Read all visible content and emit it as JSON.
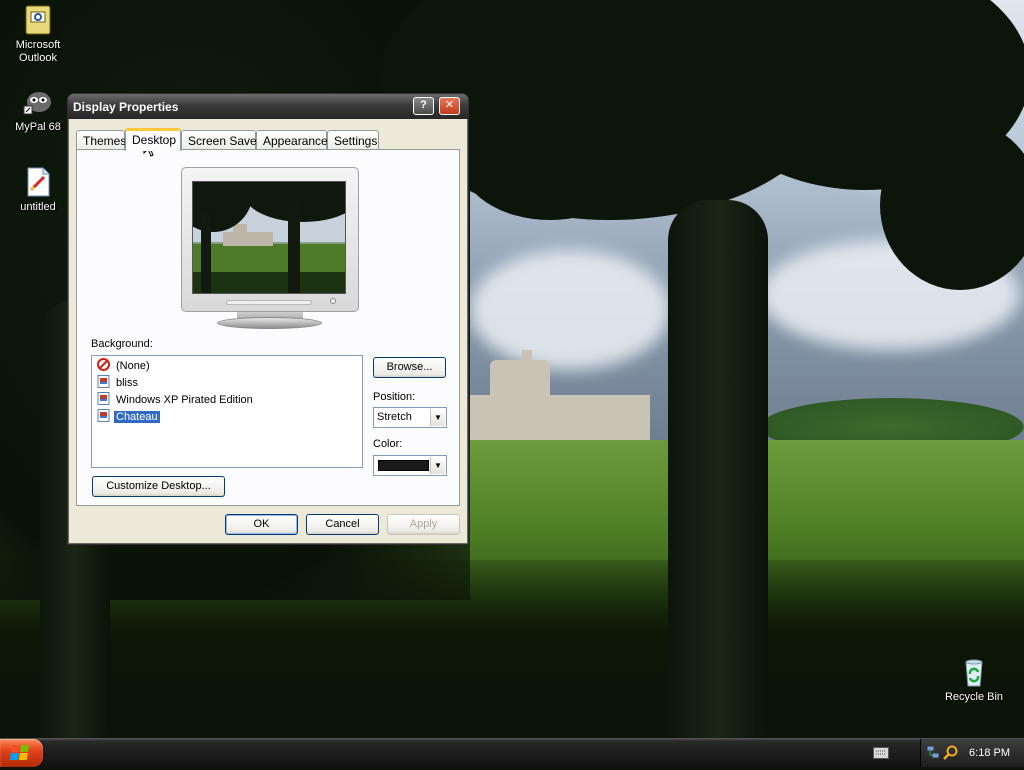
{
  "desktop": {
    "icons": [
      {
        "label": "Microsoft Outlook",
        "icon": "outlook-icon"
      },
      {
        "label": "MyPal 68",
        "icon": "mypal-icon"
      },
      {
        "label": "untitled",
        "icon": "paint-file-icon"
      },
      {
        "label": "Recycle Bin",
        "icon": "recycle-bin-icon"
      }
    ]
  },
  "window": {
    "title": "Display Properties",
    "help_button": "?",
    "close_button": "✕",
    "tabs": [
      {
        "label": "Themes",
        "active": false
      },
      {
        "label": "Desktop",
        "active": true
      },
      {
        "label": "Screen Saver",
        "active": false
      },
      {
        "label": "Appearance",
        "active": false
      },
      {
        "label": "Settings",
        "active": false
      }
    ],
    "background_label": "Background:",
    "backgrounds": [
      {
        "label": "(None)",
        "icon": "none-icon",
        "selected": false
      },
      {
        "label": "bliss",
        "icon": "image-file-icon",
        "selected": false
      },
      {
        "label": "Windows XP Pirated Edition",
        "icon": "image-file-icon",
        "selected": false
      },
      {
        "label": "Chateau",
        "icon": "image-file-icon",
        "selected": true
      }
    ],
    "browse_button": "Browse...",
    "position_label": "Position:",
    "position_value": "Stretch",
    "color_label": "Color:",
    "color_value": "#1a1a1a",
    "customize_button": "Customize Desktop...",
    "ok_button": "OK",
    "cancel_button": "Cancel",
    "apply_button": "Apply"
  },
  "taskbar": {
    "clock": "6:18 PM"
  }
}
